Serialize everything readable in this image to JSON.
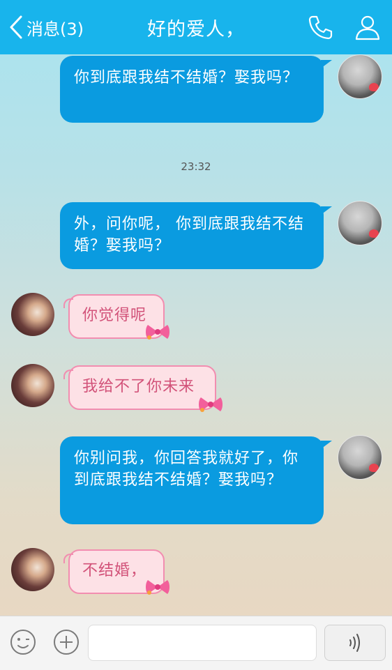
{
  "header": {
    "back_label": "消息(3)",
    "title": "好的爱人，",
    "call_icon": "phone-icon",
    "profile_icon": "user-icon"
  },
  "colors": {
    "header": "#18b4ec",
    "outgoing_bubble": "#0a9be0",
    "incoming_bubble": "#fde1e6",
    "incoming_text": "#d25279"
  },
  "messages": [
    {
      "side": "right",
      "text": "你到底跟我结不结婚？娶我吗？"
    },
    {
      "side": "right",
      "text": "外，问你呢， 你到底跟我结不结婚？娶我吗？"
    },
    {
      "side": "left",
      "text": "你觉得呢"
    },
    {
      "side": "left",
      "text": "我给不了你未来"
    },
    {
      "side": "right",
      "text": "你别问我，你回答我就好了，你到底跟我结不结婚？娶我吗？"
    },
    {
      "side": "left",
      "text": "不结婚，"
    }
  ],
  "timestamp": "23:32",
  "input": {
    "placeholder": "",
    "emoji_icon": "smiley-icon",
    "plus_icon": "plus-icon",
    "voice_icon": "voice-wave-icon"
  }
}
